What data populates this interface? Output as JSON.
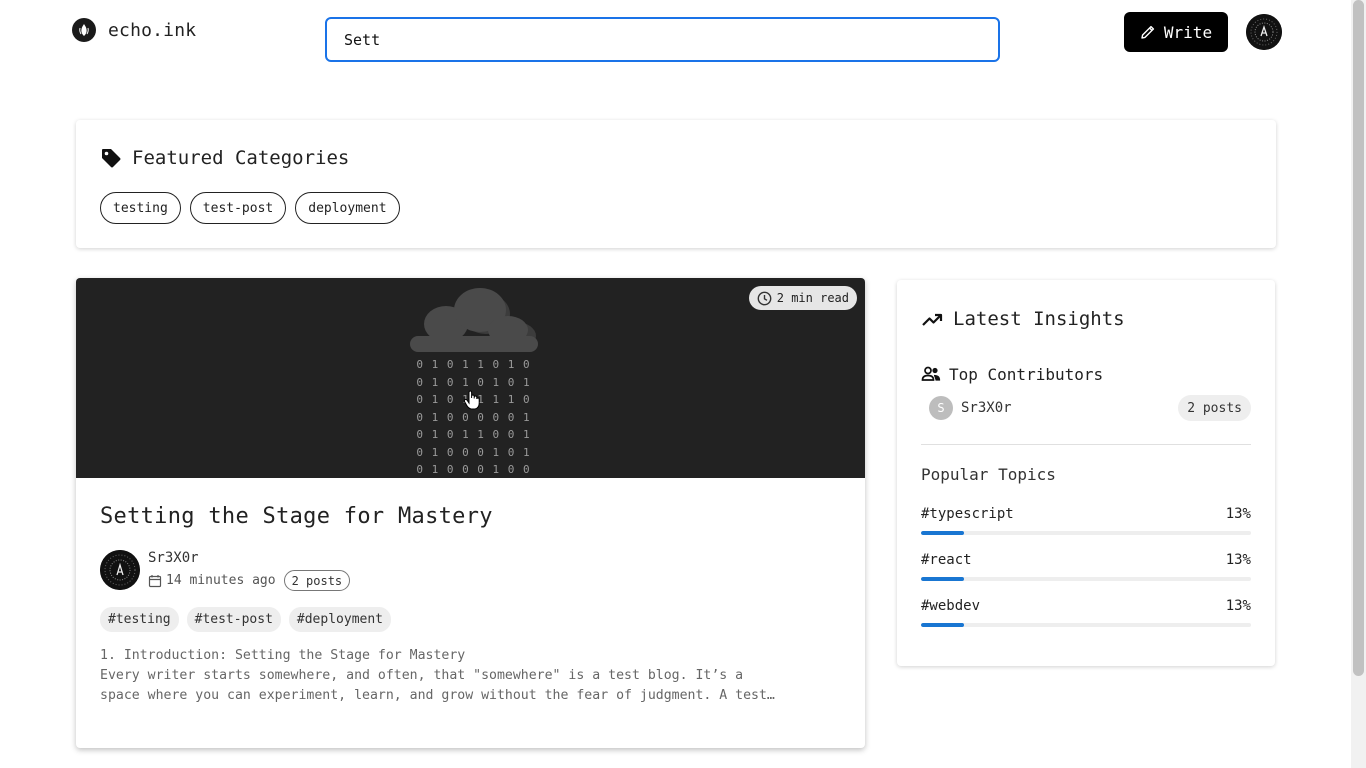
{
  "header": {
    "brand_name": "echo.ink",
    "search_value": "Sett",
    "write_label": "Write"
  },
  "featured": {
    "title": "Featured Categories",
    "categories": [
      "testing",
      "test-post",
      "deployment"
    ]
  },
  "post": {
    "read_time": "2 min read",
    "binary_lines": [
      "0 1 0 1 1 0 1 0",
      "0 1 0 1 0 1 0 1",
      "0 1 0 1 1 1 1 0",
      "0 1 0 0 0 0 0 1",
      "0 1 0 1 1 0 0 1",
      "0 1 0 0 0 1 0 1",
      "0 1 0 0 0 1 0 0"
    ],
    "title": "Setting the Stage for Mastery",
    "author": "Sr3X0r",
    "time_ago": "14 minutes ago",
    "author_posts": "2 posts",
    "tags": [
      "#testing",
      "#test-post",
      "#deployment"
    ],
    "excerpt_lines": [
      "1. Introduction: Setting the Stage for Mastery",
      "Every writer starts somewhere, and often, that \"somewhere\" is a test blog. It’s a",
      "space where you can experiment, learn, and grow without the fear of judgment. A test…"
    ]
  },
  "insights": {
    "title": "Latest Insights",
    "contributors_title": "Top Contributors",
    "contributors": [
      {
        "initial": "S",
        "name": "Sr3X0r",
        "count": "2 posts"
      }
    ],
    "topics_title": "Popular Topics",
    "topics": [
      {
        "name": "#typescript",
        "percent_label": "13%",
        "fraction": 0.13
      },
      {
        "name": "#react",
        "percent_label": "13%",
        "fraction": 0.13
      },
      {
        "name": "#webdev",
        "percent_label": "13%",
        "fraction": 0.13
      }
    ]
  },
  "colors": {
    "accent": "#1976d2",
    "search_border": "#1a73e8",
    "hero_bg": "#222222"
  }
}
